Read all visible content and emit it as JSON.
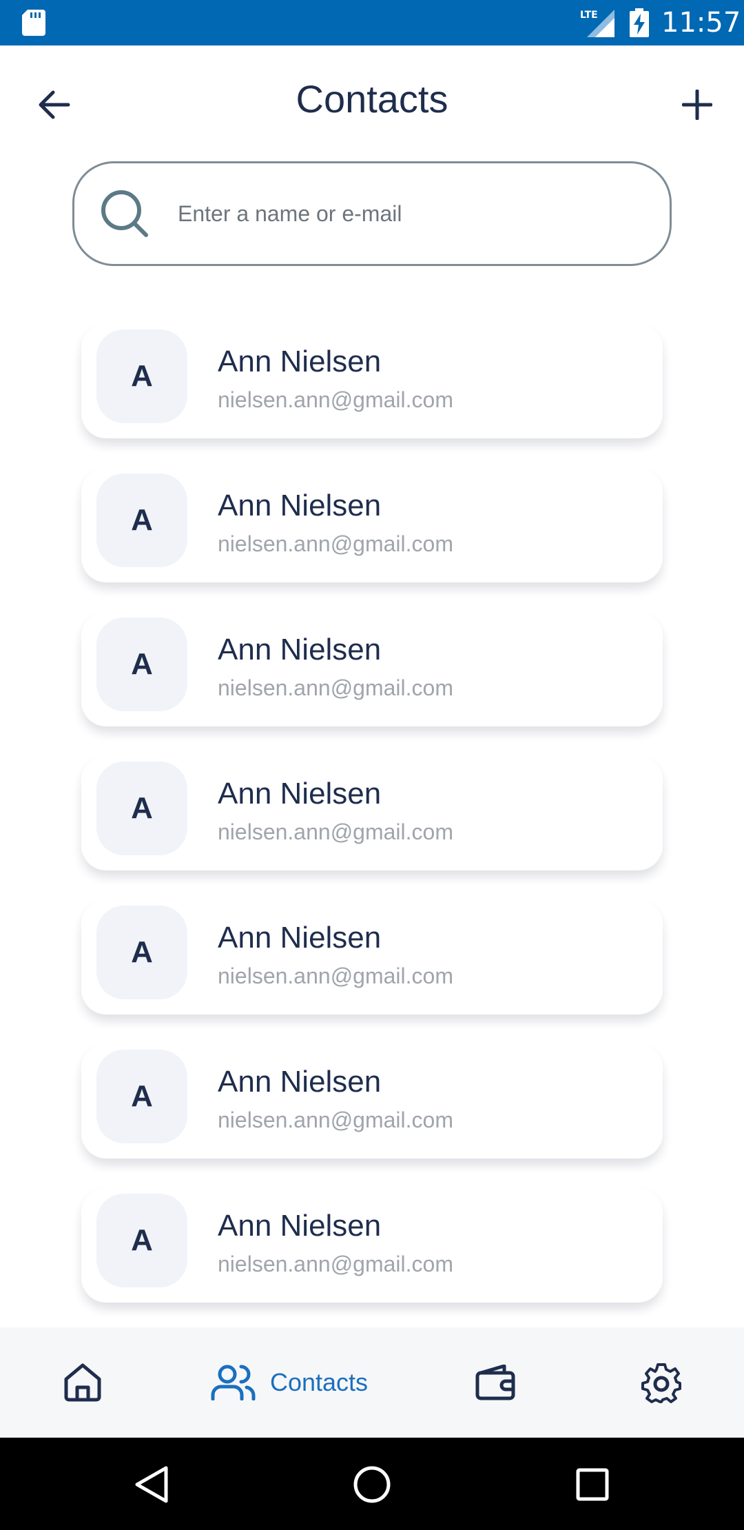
{
  "status_bar": {
    "time": "11:57",
    "network": "LTE",
    "icons": [
      "sd-card-icon",
      "signal-icon",
      "battery-charging-icon"
    ]
  },
  "header": {
    "title": "Contacts",
    "back_icon": "arrow-left-icon",
    "add_icon": "plus-icon"
  },
  "search": {
    "placeholder": "Enter a name or e-mail",
    "value": "",
    "icon": "search-icon"
  },
  "contacts": [
    {
      "initial": "A",
      "name": "Ann Nielsen",
      "email": "nielsen.ann@gmail.com"
    },
    {
      "initial": "A",
      "name": "Ann Nielsen",
      "email": "nielsen.ann@gmail.com"
    },
    {
      "initial": "A",
      "name": "Ann Nielsen",
      "email": "nielsen.ann@gmail.com"
    },
    {
      "initial": "A",
      "name": "Ann Nielsen",
      "email": "nielsen.ann@gmail.com"
    },
    {
      "initial": "A",
      "name": "Ann Nielsen",
      "email": "nielsen.ann@gmail.com"
    },
    {
      "initial": "A",
      "name": "Ann Nielsen",
      "email": "nielsen.ann@gmail.com"
    },
    {
      "initial": "A",
      "name": "Ann Nielsen",
      "email": "nielsen.ann@gmail.com"
    }
  ],
  "bottom_nav": {
    "items": [
      {
        "icon": "home-icon",
        "label": ""
      },
      {
        "icon": "users-icon",
        "label": "Contacts",
        "active": true
      },
      {
        "icon": "wallet-icon",
        "label": ""
      },
      {
        "icon": "gear-icon",
        "label": ""
      }
    ]
  },
  "colors": {
    "status_bar": "#0168b3",
    "text_primary": "#1f2d4d",
    "text_secondary": "#a0a4ab",
    "accent": "#1a6fbf",
    "avatar_bg": "#f1f3f8",
    "nav_bg": "#f6f7f8"
  }
}
